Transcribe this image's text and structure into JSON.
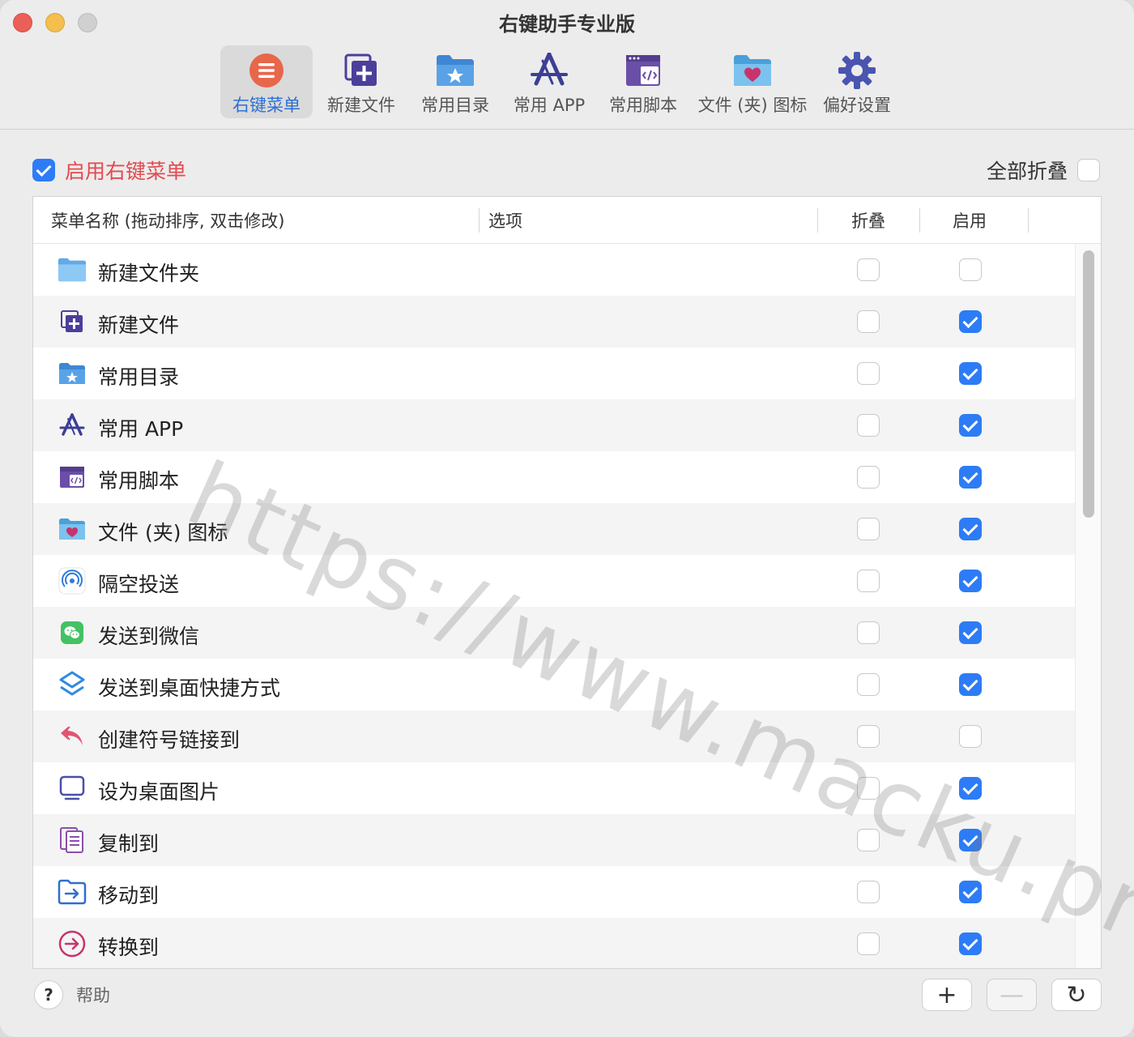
{
  "window": {
    "title": "右键助手专业版"
  },
  "toolbar": {
    "items": [
      {
        "label": "右键菜单",
        "icon": "menu-list-icon",
        "active": true
      },
      {
        "label": "新建文件",
        "icon": "new-file-icon",
        "active": false
      },
      {
        "label": "常用目录",
        "icon": "folder-star-icon",
        "active": false
      },
      {
        "label": "常用 APP",
        "icon": "app-store-icon",
        "active": false
      },
      {
        "label": "常用脚本",
        "icon": "script-window-icon",
        "active": false
      },
      {
        "label": "文件 (夹) 图标",
        "icon": "folder-heart-icon",
        "active": false
      },
      {
        "label": "偏好设置",
        "icon": "gear-icon",
        "active": false
      }
    ]
  },
  "enable_menu": {
    "label": "启用右键菜单",
    "checked": true
  },
  "collapse_all": {
    "label": "全部折叠",
    "checked": false
  },
  "table": {
    "columns": [
      "菜单名称 (拖动排序, 双击修改)",
      "选项",
      "折叠",
      "启用"
    ],
    "rows": [
      {
        "name": "新建文件夹",
        "icon": "folder-icon",
        "fold": false,
        "enabled": false
      },
      {
        "name": "新建文件",
        "icon": "new-file-icon",
        "fold": false,
        "enabled": true
      },
      {
        "name": "常用目录",
        "icon": "folder-star-icon",
        "fold": false,
        "enabled": true
      },
      {
        "name": "常用 APP",
        "icon": "app-store-icon",
        "fold": false,
        "enabled": true
      },
      {
        "name": "常用脚本",
        "icon": "script-window-icon",
        "fold": false,
        "enabled": true
      },
      {
        "name": "文件 (夹) 图标",
        "icon": "folder-heart-icon",
        "fold": false,
        "enabled": true
      },
      {
        "name": "隔空投送",
        "icon": "airdrop-icon",
        "fold": false,
        "enabled": true
      },
      {
        "name": "发送到微信",
        "icon": "wechat-icon",
        "fold": false,
        "enabled": true
      },
      {
        "name": "发送到桌面快捷方式",
        "icon": "shortcut-icon",
        "fold": false,
        "enabled": true
      },
      {
        "name": "创建符号链接到",
        "icon": "symlink-arrow-icon",
        "fold": false,
        "enabled": false
      },
      {
        "name": "设为桌面图片",
        "icon": "monitor-icon",
        "fold": false,
        "enabled": true
      },
      {
        "name": "复制到",
        "icon": "copy-document-icon",
        "fold": false,
        "enabled": true
      },
      {
        "name": "移动到",
        "icon": "move-folder-icon",
        "fold": false,
        "enabled": true
      },
      {
        "name": "转换到",
        "icon": "convert-arrow-icon",
        "fold": false,
        "enabled": true
      }
    ]
  },
  "footer": {
    "help_symbol": "?",
    "help_label": "帮助",
    "add_symbol": "+",
    "remove_symbol": "—",
    "refresh_symbol": "↻"
  },
  "watermark": "https://www.macku.pro/"
}
